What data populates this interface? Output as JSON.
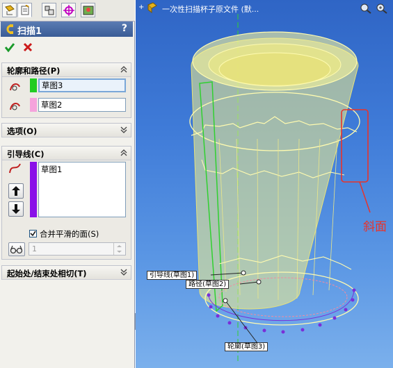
{
  "feature_manager": {
    "tabs": [
      "feature-tree-tab",
      "property-manager-tab",
      "configuration-tab",
      "dimxpert-tab",
      "display-manager-tab"
    ],
    "title": "扫描1",
    "help_label": "?",
    "ok_icon": "checkmark-icon",
    "cancel_icon": "x-icon"
  },
  "groups": {
    "profile_path": {
      "header": "轮廓和路径(P)",
      "profile_value": "草图3",
      "path_value": "草图2",
      "profile_color": "#22cc22",
      "path_color": "#f5a3dc"
    },
    "options": {
      "header": "选项(O)"
    },
    "guide_curves": {
      "header": "引导线(C)",
      "items": [
        "草图1"
      ],
      "color": "#8a11e8",
      "merge_faces_label": "合并平滑的面(S)",
      "merge_faces_checked": true,
      "spin_value": "1"
    },
    "tangency": {
      "header": "起始处/结束处相切(T)"
    }
  },
  "viewport": {
    "expand_symbol": "+",
    "document_title": "一次性扫描杯子原文件 (默...",
    "callouts": {
      "guide": "引导线(草图1)",
      "path": "路径(草图2)",
      "profile": "轮廓(草图3)"
    },
    "annotation": "斜面",
    "annotation_color": "#e8332a"
  }
}
